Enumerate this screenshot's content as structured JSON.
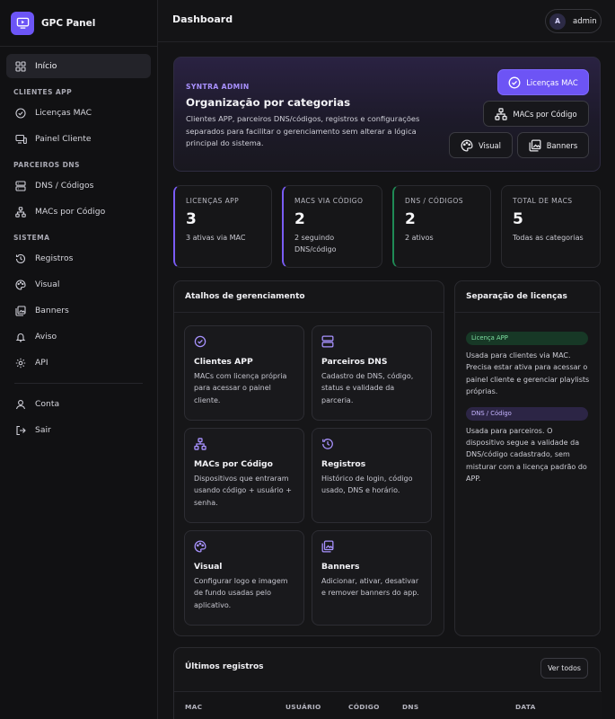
{
  "brand": {
    "name": "GPC Panel"
  },
  "sidebar": {
    "home": "Início",
    "sections": [
      {
        "title": "CLIENTES APP",
        "items": [
          "Licenças MAC",
          "Painel Cliente"
        ]
      },
      {
        "title": "PARCEIROS DNS",
        "items": [
          "DNS / Códigos",
          "MACs por Código"
        ]
      },
      {
        "title": "SISTEMA",
        "items": [
          "Registros",
          "Visual",
          "Banners",
          "Aviso",
          "API"
        ]
      }
    ],
    "bottom": [
      "Conta",
      "Sair"
    ]
  },
  "topbar": {
    "title": "Dashboard",
    "avatar_initial": "A",
    "user": "admin"
  },
  "hero": {
    "kicker": "SYNTRA ADMIN",
    "title": "Organização por categorias",
    "description": "Clientes APP, parceiros DNS/códigos, registros e configurações separados para facilitar o gerenciamento sem alterar a lógica principal do sistema.",
    "buttons": {
      "licencas": "Licenças MAC",
      "macs_codigo": "MACs por Código",
      "visual": "Visual",
      "banners": "Banners"
    }
  },
  "stats": [
    {
      "label": "LICENÇAS APP",
      "value": "3",
      "sub": "3 ativas via MAC"
    },
    {
      "label": "MACS VIA CÓDIGO",
      "value": "2",
      "sub": "2 seguindo DNS/código"
    },
    {
      "label": "DNS / CÓDIGOS",
      "value": "2",
      "sub": "2 ativos"
    },
    {
      "label": "TOTAL DE MACS",
      "value": "5",
      "sub": "Todas as categorias"
    }
  ],
  "shortcuts": {
    "title": "Atalhos de gerenciamento",
    "tiles": [
      {
        "title": "Clientes APP",
        "desc": "MACs com licença própria para acessar o painel cliente."
      },
      {
        "title": "Parceiros DNS",
        "desc": "Cadastro de DNS, código, status e validade da parceria."
      },
      {
        "title": "MACs por Código",
        "desc": "Dispositivos que entraram usando código + usuário + senha."
      },
      {
        "title": "Registros",
        "desc": "Histórico de login, código usado, DNS e horário."
      },
      {
        "title": "Visual",
        "desc": "Configurar logo e imagem de fundo usadas pelo aplicativo."
      },
      {
        "title": "Banners",
        "desc": "Adicionar, ativar, desativar e remover banners do app."
      }
    ]
  },
  "separation": {
    "title": "Separação de licenças",
    "badge_app": "Licença APP",
    "text_app": "Usada para clientes via MAC. Precisa estar ativa para acessar o painel cliente e gerenciar playlists próprias.",
    "badge_dns": "DNS / Código",
    "text_dns": "Usada para parceiros. O dispositivo segue a validade da DNS/código cadastrado, sem misturar com a licença padrão do APP."
  },
  "records": {
    "title": "Últimos registros",
    "view_all": "Ver todos",
    "columns": [
      "MAC",
      "USUÁRIO",
      "CÓDIGO",
      "DNS",
      "DATA"
    ]
  },
  "colors": {
    "accent": "#6d54f5",
    "success": "#1f8a55",
    "background": "#131315"
  }
}
